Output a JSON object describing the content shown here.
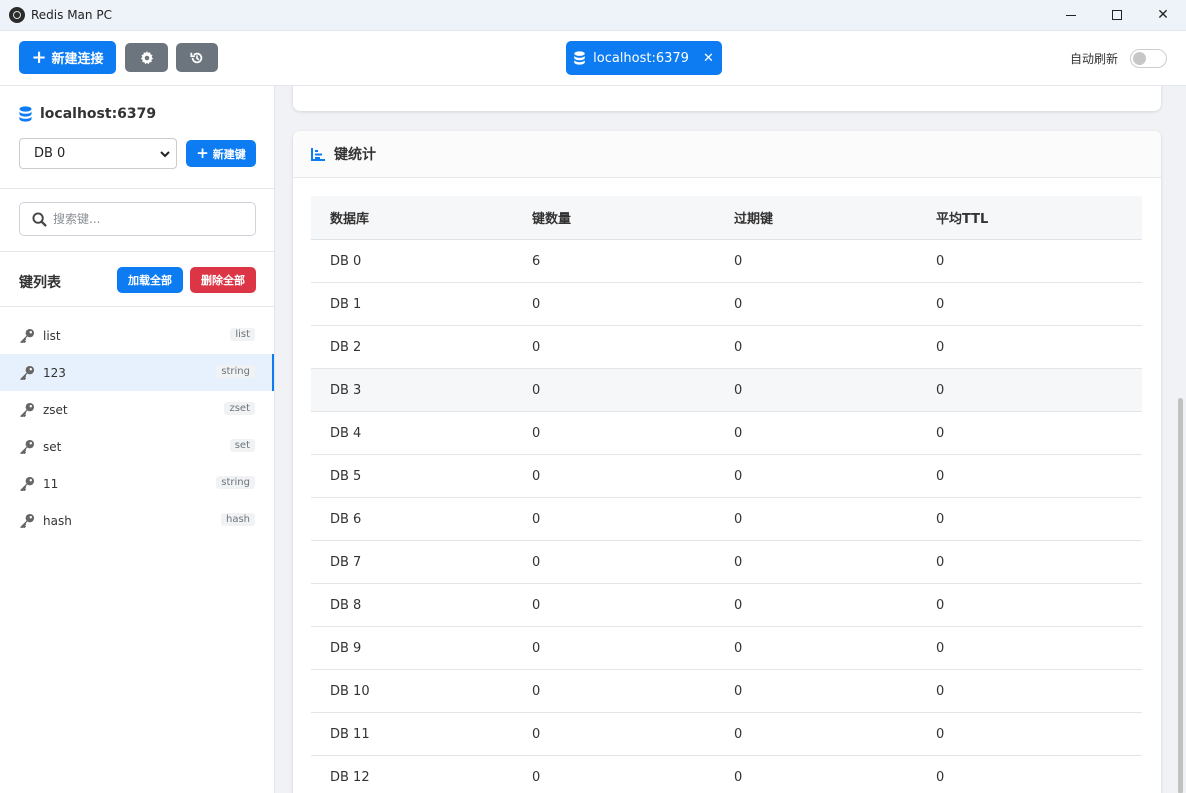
{
  "window": {
    "title": "Redis Man PC",
    "controls": {
      "minimize": "",
      "maximize": "",
      "close": "✕"
    }
  },
  "toolbar": {
    "new_connection_label": "新建连接",
    "connection_tab_label": "localhost:6379",
    "auto_refresh_label": "自动刷新",
    "auto_refresh_on": false
  },
  "sidebar": {
    "connection_name": "localhost:6379",
    "db_selected": "DB 0",
    "new_key_label": "新建键",
    "search_placeholder": "搜索键...",
    "key_list_title": "键列表",
    "load_all_label": "加载全部",
    "delete_all_label": "删除全部",
    "keys": [
      {
        "name": "list",
        "type": "list",
        "active": false
      },
      {
        "name": "123",
        "type": "string",
        "active": true
      },
      {
        "name": "zset",
        "type": "zset",
        "active": false
      },
      {
        "name": "set",
        "type": "set",
        "active": false
      },
      {
        "name": "11",
        "type": "string",
        "active": false
      },
      {
        "name": "hash",
        "type": "hash",
        "active": false
      }
    ]
  },
  "main": {
    "stats_title": "键统计",
    "table": {
      "headers": [
        "数据库",
        "键数量",
        "过期键",
        "平均TTL"
      ],
      "rows": [
        [
          "DB 0",
          "6",
          "0",
          "0"
        ],
        [
          "DB 1",
          "0",
          "0",
          "0"
        ],
        [
          "DB 2",
          "0",
          "0",
          "0"
        ],
        [
          "DB 3",
          "0",
          "0",
          "0"
        ],
        [
          "DB 4",
          "0",
          "0",
          "0"
        ],
        [
          "DB 5",
          "0",
          "0",
          "0"
        ],
        [
          "DB 6",
          "0",
          "0",
          "0"
        ],
        [
          "DB 7",
          "0",
          "0",
          "0"
        ],
        [
          "DB 8",
          "0",
          "0",
          "0"
        ],
        [
          "DB 9",
          "0",
          "0",
          "0"
        ],
        [
          "DB 10",
          "0",
          "0",
          "0"
        ],
        [
          "DB 11",
          "0",
          "0",
          "0"
        ],
        [
          "DB 12",
          "0",
          "0",
          "0"
        ]
      ]
    }
  },
  "colors": {
    "primary": "#0d7cf2",
    "secondary": "#6c757d",
    "danger": "#dc3545",
    "active_row": "#e6f1fd"
  },
  "icons": {
    "app": "redis-man-icon",
    "settings": "gear-icon",
    "history": "history-icon",
    "database": "database-icon",
    "search": "search-icon",
    "key": "key-icon",
    "chart": "bar-chart-icon"
  }
}
